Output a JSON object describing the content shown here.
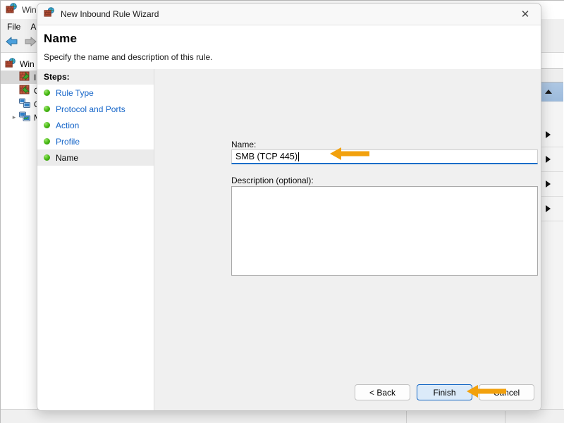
{
  "background_window": {
    "title": "Wind",
    "icon": "firewall-globe-icon",
    "menu": [
      {
        "label": "File"
      },
      {
        "label": "A"
      }
    ],
    "toolbar": [
      {
        "icon": "back-arrow-icon"
      },
      {
        "icon": "forward-arrow-icon"
      }
    ],
    "tree": [
      {
        "label": "Win",
        "icon": "firewall-globe-icon",
        "level": 0,
        "selected": false,
        "expander": false
      },
      {
        "label": "I",
        "icon": "inbound-rules-icon",
        "level": 1,
        "selected": true,
        "expander": false
      },
      {
        "label": "O",
        "icon": "outbound-rules-icon",
        "level": 1,
        "selected": false,
        "expander": false
      },
      {
        "label": "C",
        "icon": "connection-security-rules-icon",
        "level": 1,
        "selected": false,
        "expander": false
      },
      {
        "label": "M",
        "icon": "monitoring-icon",
        "level": 1,
        "selected": false,
        "expander": true
      }
    ],
    "actions_pane": {
      "scroll_up": "scroll-up-arrow",
      "sections": [
        {
          "icon": "expander-triangle-icon"
        },
        {
          "icon": "expander-triangle-icon"
        },
        {
          "icon": "expander-triangle-icon"
        },
        {
          "icon": "expander-triangle-icon"
        }
      ]
    }
  },
  "dialog": {
    "title": "New Inbound Rule Wizard",
    "title_icon": "firewall-globe-icon",
    "close_label": "✕",
    "header": {
      "heading": "Name",
      "subheading": "Specify the name and description of this rule."
    },
    "steps": {
      "title": "Steps:",
      "items": [
        {
          "label": "Rule Type",
          "state": "done"
        },
        {
          "label": "Protocol and Ports",
          "state": "done"
        },
        {
          "label": "Action",
          "state": "done"
        },
        {
          "label": "Profile",
          "state": "done"
        },
        {
          "label": "Name",
          "state": "current"
        }
      ]
    },
    "fields": {
      "name_label": "Name:",
      "name_value": "SMB (TCP 445)",
      "description_label": "Description (optional):",
      "description_value": ""
    },
    "buttons": {
      "back": "< Back",
      "finish": "Finish",
      "cancel": "Cancel"
    }
  },
  "annotations": {
    "arrow_color": "#F2A10D",
    "name_arrow": "left-arrow-pointing-to-name-field",
    "finish_arrow": "left-arrow-pointing-to-finish-button"
  }
}
